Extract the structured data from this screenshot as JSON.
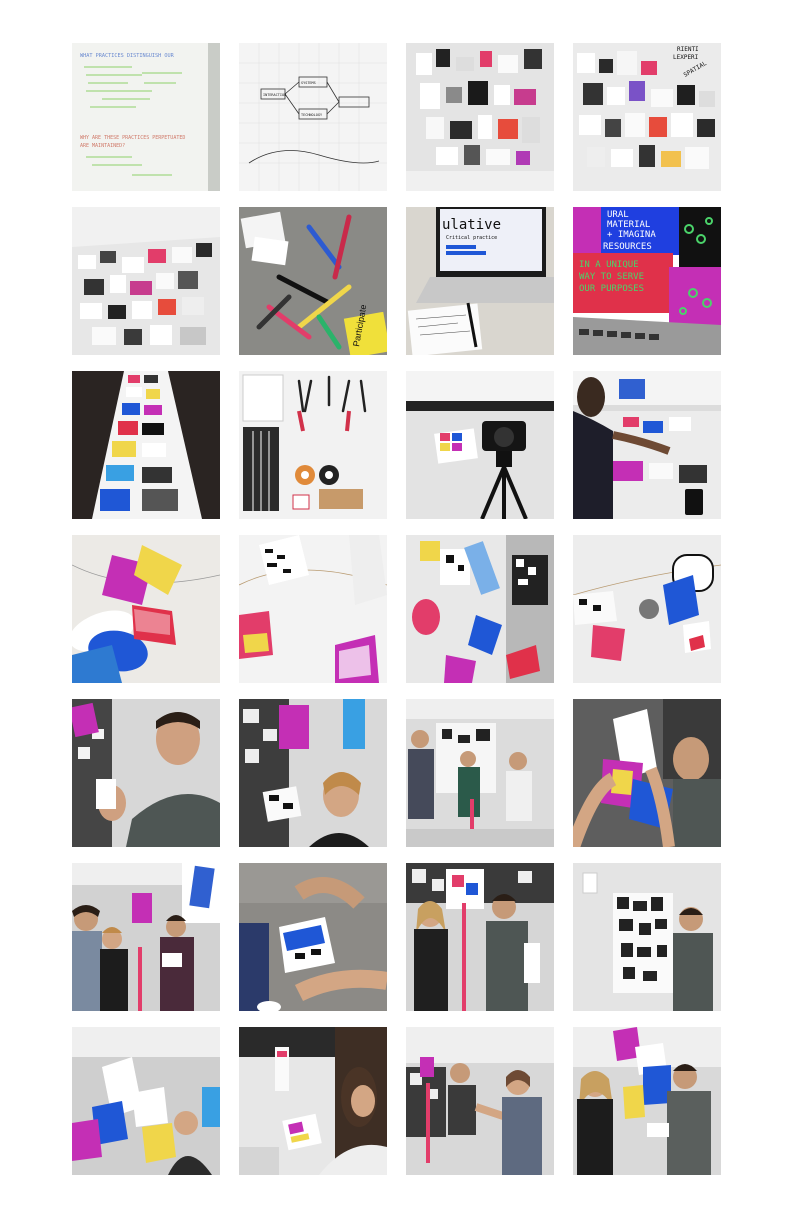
{
  "page": {
    "background": "#ffffff"
  },
  "tiles": [
    {
      "caption": "whiteboard",
      "texts": {
        "t1": "WHAT PRACTICES DISTINGUISH OUR",
        "t2": "WHY ARE THESE PRACTICES PERPETUATED",
        "t3": "ARE MAINTAINED?"
      }
    },
    {
      "caption": "grid-paper-sketch",
      "texts": {
        "t1": "INTERACTION",
        "t2": "SYSTEMS",
        "t3": "TECHNOLOGY"
      }
    },
    {
      "caption": "pinned-wall-1",
      "texts": {}
    },
    {
      "caption": "pinned-wall-2",
      "texts": {
        "t1": "RIENTI",
        "t2": "LEXPERI",
        "t3": "SPATIAL"
      }
    },
    {
      "caption": "table-prints",
      "texts": {}
    },
    {
      "caption": "markers",
      "texts": {}
    },
    {
      "caption": "laptop-speculative",
      "texts": {
        "t1": "ulative",
        "t2": "Critical practice"
      }
    },
    {
      "caption": "laptop-poster",
      "texts": {
        "t1": "URAL",
        "t2": "MATERIAL",
        "t3": "+ IMAGINA",
        "t4": "RESOURCES",
        "t5": "IN A UNIQUE",
        "t6": "WAY TO SERVE",
        "t7": "OUR PURPOSES"
      }
    },
    {
      "caption": "print-strip",
      "texts": {
        "t1": "Participate"
      }
    },
    {
      "caption": "tools",
      "texts": {}
    },
    {
      "caption": "camera-table",
      "texts": {}
    },
    {
      "caption": "person-cutting",
      "texts": {}
    },
    {
      "caption": "mobile-1",
      "texts": {}
    },
    {
      "caption": "mobile-2",
      "texts": {}
    },
    {
      "caption": "mobile-3",
      "texts": {}
    },
    {
      "caption": "mobile-4",
      "texts": {}
    },
    {
      "caption": "man-holding",
      "texts": {}
    },
    {
      "caption": "woman-mobile",
      "texts": {}
    },
    {
      "caption": "three-people",
      "texts": {}
    },
    {
      "caption": "hands-up",
      "texts": {}
    },
    {
      "caption": "group-three",
      "texts": {}
    },
    {
      "caption": "hands-cube",
      "texts": {}
    },
    {
      "caption": "pair-mobile",
      "texts": {}
    },
    {
      "caption": "man-wall",
      "texts": {}
    },
    {
      "caption": "woman-hanging",
      "texts": {}
    },
    {
      "caption": "woman-reading",
      "texts": {}
    },
    {
      "caption": "pair-mobile-2",
      "texts": {}
    },
    {
      "caption": "pair-mobile-3",
      "texts": {}
    }
  ]
}
